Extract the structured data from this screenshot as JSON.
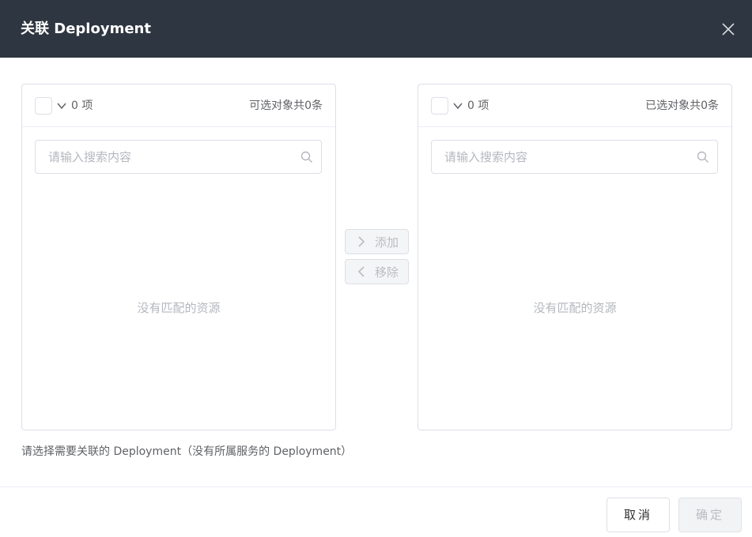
{
  "dialog": {
    "title": "关联 Deployment"
  },
  "source_panel": {
    "count_label": "0 项",
    "total_label": "可选对象共0条",
    "search_placeholder": "请输入搜索内容",
    "empty_text": "没有匹配的资源"
  },
  "target_panel": {
    "count_label": "0 项",
    "total_label": "已选对象共0条",
    "search_placeholder": "请输入搜索内容",
    "empty_text": "没有匹配的资源"
  },
  "transfer": {
    "add_label": "添加",
    "remove_label": "移除"
  },
  "hint": "请选择需要关联的 Deployment（没有所属服务的 Deployment）",
  "footer": {
    "cancel_label": "取消",
    "confirm_label": "确定"
  },
  "icons": {
    "close": "close-icon",
    "caret": "chevron-down-icon",
    "search": "search-icon",
    "add": "chevron-right-icon",
    "remove": "chevron-left-icon"
  },
  "colors": {
    "header_bg": "#2e3641",
    "border": "#dcdfe6",
    "placeholder": "#b4b7bd",
    "text": "#606266"
  }
}
